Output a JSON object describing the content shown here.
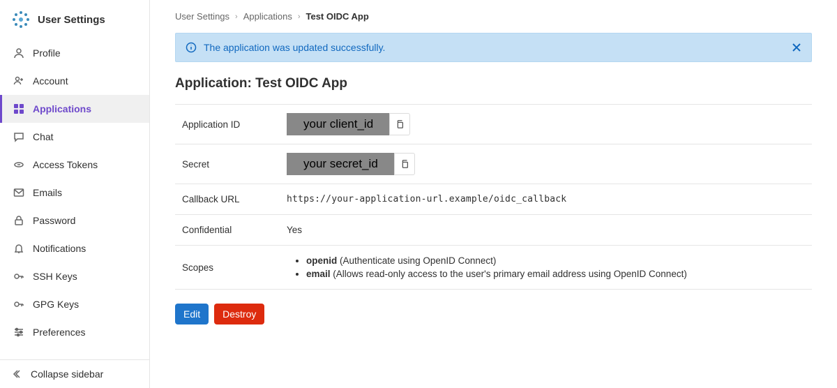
{
  "sidebar": {
    "title": "User Settings",
    "items": [
      {
        "label": "Profile",
        "icon": "profile-icon"
      },
      {
        "label": "Account",
        "icon": "account-icon"
      },
      {
        "label": "Applications",
        "icon": "applications-icon",
        "active": true
      },
      {
        "label": "Chat",
        "icon": "chat-icon"
      },
      {
        "label": "Access Tokens",
        "icon": "access-tokens-icon"
      },
      {
        "label": "Emails",
        "icon": "emails-icon"
      },
      {
        "label": "Password",
        "icon": "password-icon"
      },
      {
        "label": "Notifications",
        "icon": "notifications-icon"
      },
      {
        "label": "SSH Keys",
        "icon": "ssh-keys-icon"
      },
      {
        "label": "GPG Keys",
        "icon": "gpg-keys-icon"
      },
      {
        "label": "Preferences",
        "icon": "preferences-icon"
      }
    ],
    "collapse_label": "Collapse sidebar"
  },
  "breadcrumb": {
    "items": [
      "User Settings",
      "Applications",
      "Test OIDC App"
    ]
  },
  "alert": {
    "message": "The application was updated successfully."
  },
  "heading": {
    "prefix": "Application: ",
    "name": "Test OIDC App"
  },
  "details": {
    "application_id": {
      "label": "Application ID",
      "value": "your client_id"
    },
    "secret": {
      "label": "Secret",
      "value": "your secret_id"
    },
    "callback_url": {
      "label": "Callback URL",
      "value": "https://your-application-url.example/oidc_callback"
    },
    "confidential": {
      "label": "Confidential",
      "value": "Yes"
    },
    "scopes": {
      "label": "Scopes",
      "items": [
        {
          "name": "openid",
          "desc": " (Authenticate using OpenID Connect)"
        },
        {
          "name": "email",
          "desc": " (Allows read-only access to the user's primary email address using OpenID Connect)"
        }
      ]
    }
  },
  "actions": {
    "edit": "Edit",
    "destroy": "Destroy"
  }
}
